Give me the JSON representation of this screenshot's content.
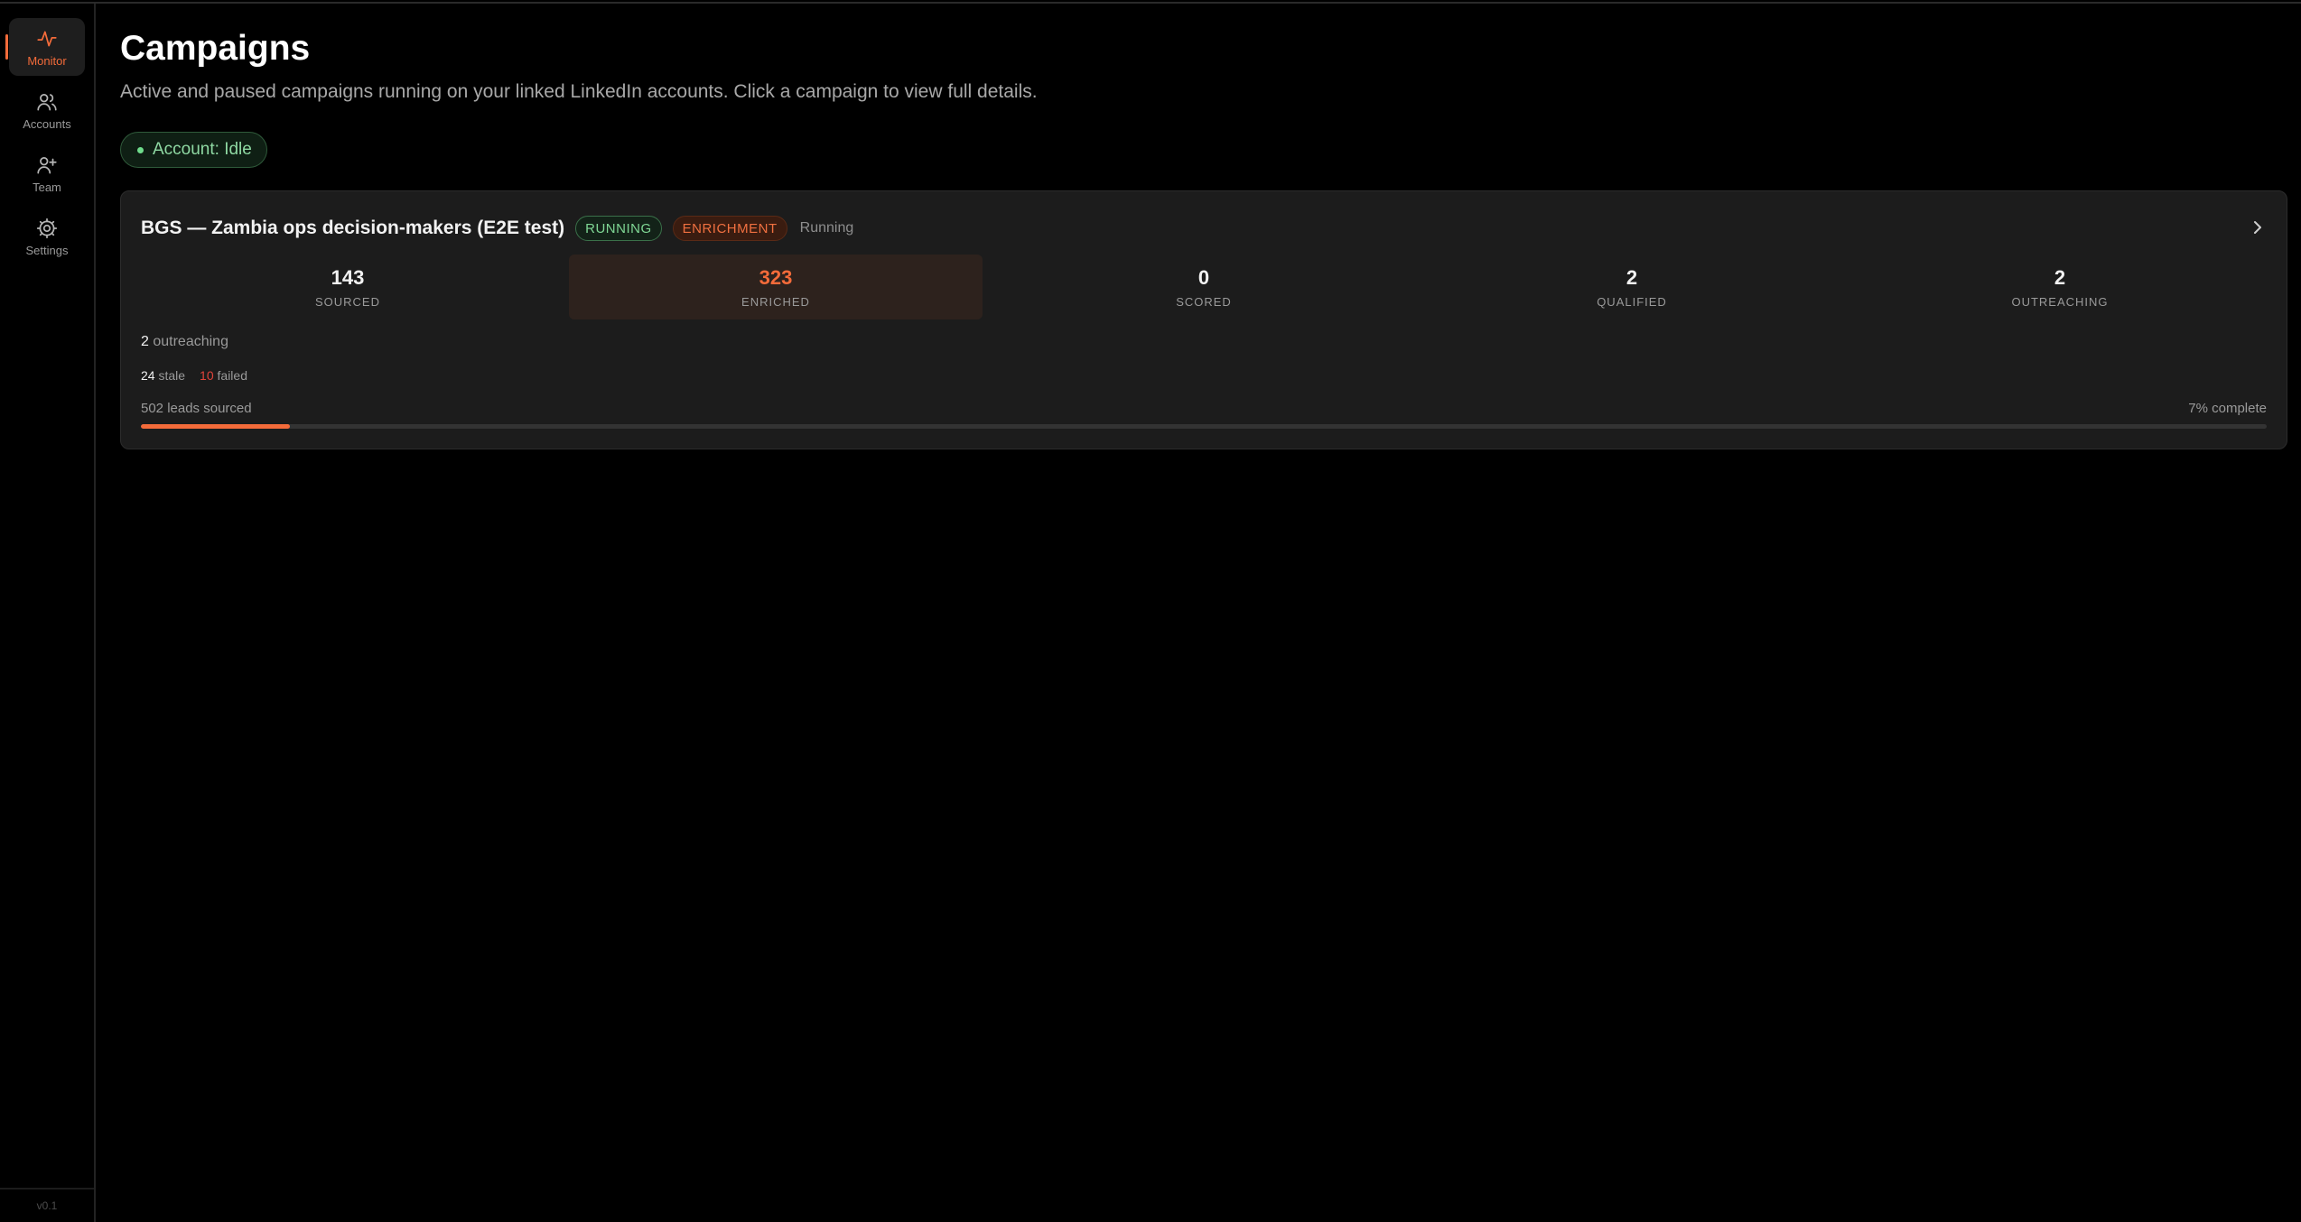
{
  "sidebar": {
    "items": [
      {
        "label": "Monitor",
        "icon": "activity-icon",
        "active": true
      },
      {
        "label": "Accounts",
        "icon": "users-icon",
        "active": false
      },
      {
        "label": "Team",
        "icon": "user-plus-icon",
        "active": false
      },
      {
        "label": "Settings",
        "icon": "gear-icon",
        "active": false
      }
    ],
    "version": "v0.1"
  },
  "header": {
    "title": "Campaigns",
    "subtitle": "Active and paused campaigns running on your linked LinkedIn accounts. Click a campaign to view full details."
  },
  "account_status": {
    "label": "Account: Idle",
    "color": "#6fdc8c"
  },
  "campaign": {
    "name": "BGS — Zambia ops decision-makers (E2E test)",
    "state_pill": "RUNNING",
    "stage_pill": "ENRICHMENT",
    "status_text": "Running",
    "stats": [
      {
        "value": "143",
        "label": "SOURCED"
      },
      {
        "value": "323",
        "label": "ENRICHED",
        "highlight": true
      },
      {
        "value": "0",
        "label": "SCORED"
      },
      {
        "value": "2",
        "label": "QUALIFIED"
      },
      {
        "value": "2",
        "label": "OUTREACHING"
      }
    ],
    "outreaching_count": "2",
    "outreaching_label": " outreaching",
    "stale_count": "24",
    "stale_label": " stale",
    "failed_count": "10",
    "failed_label": " failed",
    "leads_sourced_text": "502 leads sourced",
    "complete_text": "7% complete",
    "progress_percent": 7
  },
  "colors": {
    "accent": "#f36b3a",
    "running": "#7fd694",
    "failed": "#e0443a",
    "background": "#000000",
    "card": "#1c1c1c"
  }
}
